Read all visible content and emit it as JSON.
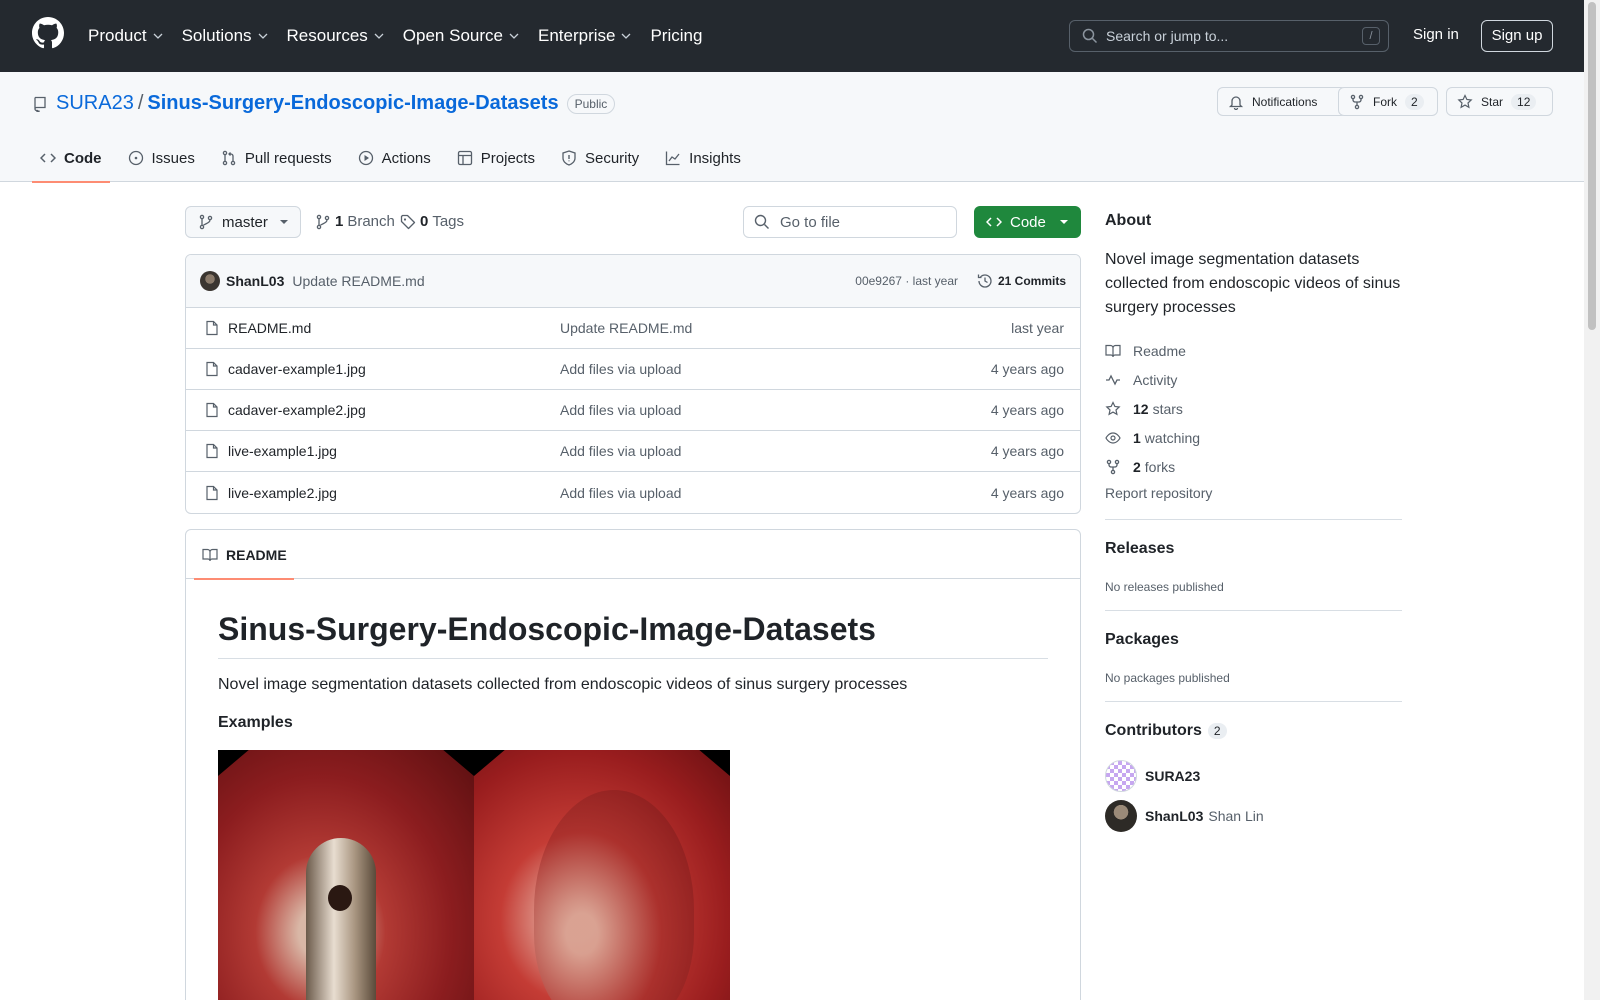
{
  "header": {
    "nav": [
      "Product",
      "Solutions",
      "Resources",
      "Open Source",
      "Enterprise",
      "Pricing"
    ],
    "search_placeholder": "Search or jump to...",
    "search_key": "/",
    "sign_in": "Sign in",
    "sign_up": "Sign up"
  },
  "repo": {
    "owner": "SURA23",
    "separator": "/",
    "name": "Sinus-Surgery-Endoscopic-Image-Datasets",
    "visibility": "Public",
    "notifications": "Notifications",
    "fork_label": "Fork",
    "fork_count": "2",
    "star_label": "Star",
    "star_count": "12"
  },
  "tabs": [
    "Code",
    "Issues",
    "Pull requests",
    "Actions",
    "Projects",
    "Security",
    "Insights"
  ],
  "toolbar": {
    "branch": "master",
    "branch_count": "1",
    "branch_label": "Branch",
    "tag_count": "0",
    "tag_label": "Tags",
    "goto_file": "Go to file",
    "code_button": "Code"
  },
  "commit": {
    "author": "ShanL03",
    "message": "Update README.md",
    "hash_time": "00e9267 · last year",
    "commits": "21 Commits"
  },
  "files": [
    {
      "name": "README.md",
      "message": "Update README.md",
      "age": "last year"
    },
    {
      "name": "cadaver-example1.jpg",
      "message": "Add files via upload",
      "age": "4 years ago"
    },
    {
      "name": "cadaver-example2.jpg",
      "message": "Add files via upload",
      "age": "4 years ago"
    },
    {
      "name": "live-example1.jpg",
      "message": "Add files via upload",
      "age": "4 years ago"
    },
    {
      "name": "live-example2.jpg",
      "message": "Add files via upload",
      "age": "4 years ago"
    }
  ],
  "readme": {
    "tab": "README",
    "title": "Sinus-Surgery-Endoscopic-Image-Datasets",
    "description": "Novel image segmentation datasets collected from endoscopic videos of sinus surgery processes",
    "examples_heading": "Examples"
  },
  "about": {
    "heading": "About",
    "description": "Novel image segmentation datasets collected from endoscopic videos of sinus surgery processes",
    "readme": "Readme",
    "activity": "Activity",
    "stars_count": "12",
    "stars_label": "stars",
    "watching_count": "1",
    "watching_label": "watching",
    "forks_count": "2",
    "forks_label": "forks",
    "report": "Report repository"
  },
  "releases": {
    "heading": "Releases",
    "empty": "No releases published"
  },
  "packages": {
    "heading": "Packages",
    "empty": "No packages published"
  },
  "contributors": {
    "heading": "Contributors",
    "count": "2",
    "list": [
      {
        "login": "SURA23",
        "name": ""
      },
      {
        "login": "ShanL03",
        "name": "Shan Lin"
      }
    ]
  }
}
